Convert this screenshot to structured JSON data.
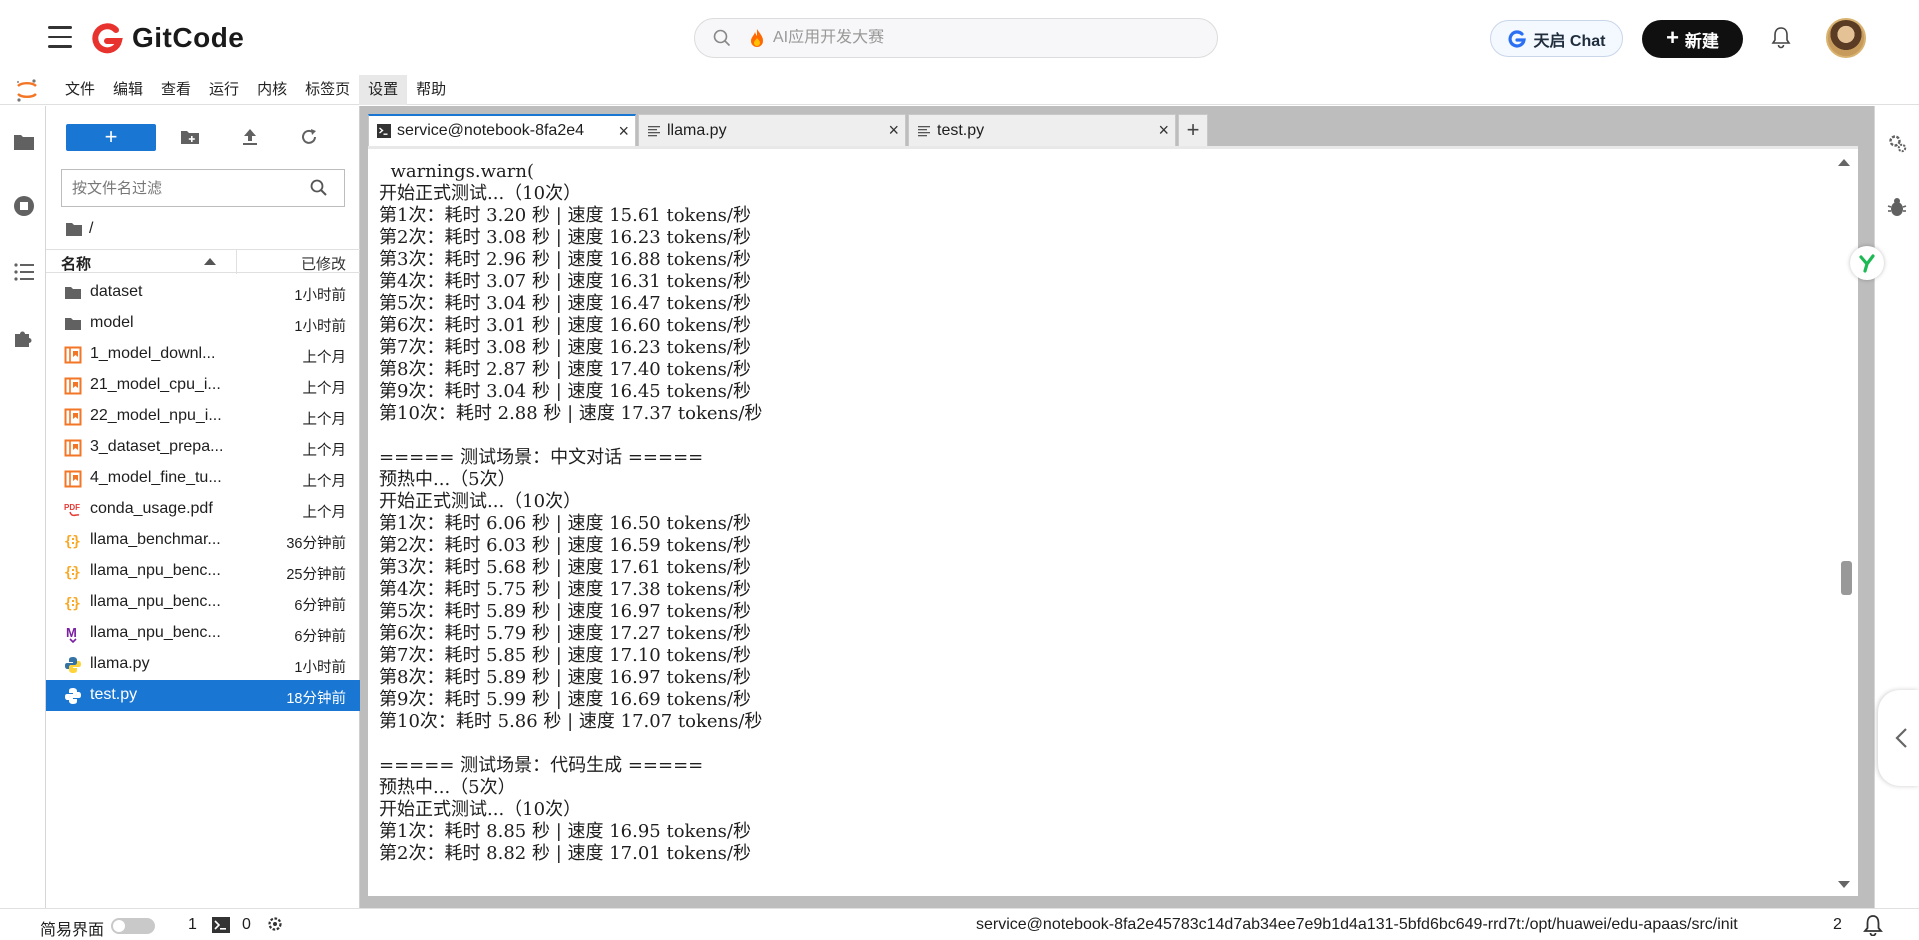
{
  "topbar": {
    "brand": "GitCode",
    "search_placeholder": "AI应用开发大赛",
    "chat_button": "天启 Chat",
    "new_button": "新建",
    "colors": {
      "brand_red": "#e8322e",
      "new_button_bg": "#101010"
    }
  },
  "menubar": {
    "items": [
      "文件",
      "编辑",
      "查看",
      "运行",
      "内核",
      "标签页",
      "设置",
      "帮助"
    ],
    "active": "设置"
  },
  "filebrowser": {
    "filter_placeholder": "按文件名过滤",
    "breadcrumb": "/",
    "header_name": "名称",
    "header_modified": "已修改",
    "files": [
      {
        "name": "dataset",
        "modified": "1小时前",
        "icon": "folder-icon"
      },
      {
        "name": "model",
        "modified": "1小时前",
        "icon": "folder-icon"
      },
      {
        "name": "1_model_downl...",
        "modified": "上个月",
        "icon": "notebook-icon"
      },
      {
        "name": "21_model_cpu_i...",
        "modified": "上个月",
        "icon": "notebook-icon"
      },
      {
        "name": "22_model_npu_i...",
        "modified": "上个月",
        "icon": "notebook-icon"
      },
      {
        "name": "3_dataset_prepa...",
        "modified": "上个月",
        "icon": "notebook-icon"
      },
      {
        "name": "4_model_fine_tu...",
        "modified": "上个月",
        "icon": "notebook-icon"
      },
      {
        "name": "conda_usage.pdf",
        "modified": "上个月",
        "icon": "pdf-icon"
      },
      {
        "name": "llama_benchmar...",
        "modified": "36分钟前",
        "icon": "json-icon"
      },
      {
        "name": "llama_npu_benc...",
        "modified": "25分钟前",
        "icon": "json-icon"
      },
      {
        "name": "llama_npu_benc...",
        "modified": "6分钟前",
        "icon": "json-icon"
      },
      {
        "name": "llama_npu_benc...",
        "modified": "6分钟前",
        "icon": "markdown-icon"
      },
      {
        "name": "llama.py",
        "modified": "1小时前",
        "icon": "python-icon"
      },
      {
        "name": "test.py",
        "modified": "18分钟前",
        "icon": "python-icon",
        "selected": true
      }
    ]
  },
  "tabs": [
    {
      "label": "service@notebook-8fa2e4",
      "icon": "terminal-icon",
      "active": true
    },
    {
      "label": "llama.py",
      "icon": "text-file-icon",
      "active": false
    },
    {
      "label": "test.py",
      "icon": "text-file-icon",
      "active": false
    }
  ],
  "terminal": {
    "lines": [
      "  warnings.warn(",
      "开始正式测试...（10次）",
      "第1次：耗时 3.20 秒 | 速度 15.61 tokens/秒",
      "第2次：耗时 3.08 秒 | 速度 16.23 tokens/秒",
      "第3次：耗时 2.96 秒 | 速度 16.88 tokens/秒",
      "第4次：耗时 3.07 秒 | 速度 16.31 tokens/秒",
      "第5次：耗时 3.04 秒 | 速度 16.47 tokens/秒",
      "第6次：耗时 3.01 秒 | 速度 16.60 tokens/秒",
      "第7次：耗时 3.08 秒 | 速度 16.23 tokens/秒",
      "第8次：耗时 2.87 秒 | 速度 17.40 tokens/秒",
      "第9次：耗时 3.04 秒 | 速度 16.45 tokens/秒",
      "第10次：耗时 2.88 秒 | 速度 17.37 tokens/秒",
      "",
      "===== 测试场景：中文对话 =====",
      "预热中...（5次）",
      "开始正式测试...（10次）",
      "第1次：耗时 6.06 秒 | 速度 16.50 tokens/秒",
      "第2次：耗时 6.03 秒 | 速度 16.59 tokens/秒",
      "第3次：耗时 5.68 秒 | 速度 17.61 tokens/秒",
      "第4次：耗时 5.75 秒 | 速度 17.38 tokens/秒",
      "第5次：耗时 5.89 秒 | 速度 16.97 tokens/秒",
      "第6次：耗时 5.79 秒 | 速度 17.27 tokens/秒",
      "第7次：耗时 5.85 秒 | 速度 17.10 tokens/秒",
      "第8次：耗时 5.89 秒 | 速度 16.97 tokens/秒",
      "第9次：耗时 5.99 秒 | 速度 16.69 tokens/秒",
      "第10次：耗时 5.86 秒 | 速度 17.07 tokens/秒",
      "",
      "===== 测试场景：代码生成 =====",
      "预热中...（5次）",
      "开始正式测试...（10次）",
      "第1次：耗时 8.85 秒 | 速度 16.95 tokens/秒",
      "第2次：耗时 8.82 秒 | 速度 17.01 tokens/秒"
    ]
  },
  "statusbar": {
    "simple_mode": "简易界面",
    "count1": "1",
    "count2": "0",
    "path": "service@notebook-8fa2e45783c14d7ab34ee7e9b1d4a131-5bfd6bc649-rrd7t:/opt/huawei/edu-apaas/src/init",
    "count3": "2"
  }
}
